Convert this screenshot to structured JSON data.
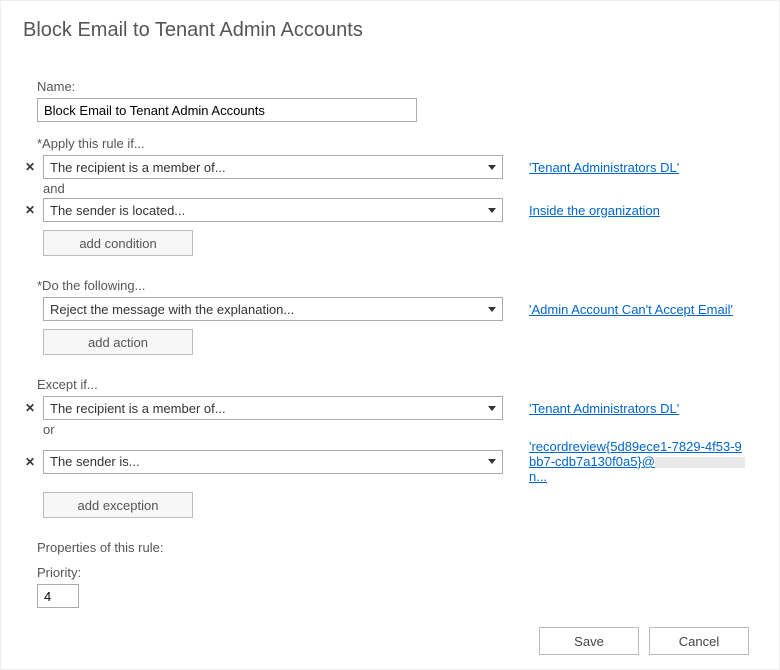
{
  "title": "Block Email to Tenant Admin Accounts",
  "labels": {
    "name": "Name:",
    "applyIf": "*Apply this rule if...",
    "and": "and",
    "doFollowing": "*Do the following...",
    "exceptIf": "Except if...",
    "or": "or",
    "properties": "Properties of this rule:",
    "priority": "Priority:"
  },
  "buttons": {
    "addCondition": "add condition",
    "addAction": "add action",
    "addException": "add exception",
    "save": "Save",
    "cancel": "Cancel"
  },
  "fields": {
    "name_value": "Block Email to Tenant Admin Accounts",
    "priority_value": "4"
  },
  "conditions": [
    {
      "predicate": "The recipient is a member of...",
      "value": "'Tenant Administrators DL'"
    },
    {
      "predicate": "The sender is located...",
      "value": "Inside the organization"
    }
  ],
  "actions": [
    {
      "predicate": "Reject the message with the explanation...",
      "value": "'Admin Account Can't Accept Email'"
    }
  ],
  "exceptions": [
    {
      "predicate": "The recipient is a member of...",
      "value": "'Tenant Administrators DL'"
    },
    {
      "predicate": "The sender is...",
      "value_prefix": "'recordreview{5d89ece1-7829-4f53-9bb7-cdb7a130f0a5}@",
      "value_suffix": "n..."
    }
  ]
}
